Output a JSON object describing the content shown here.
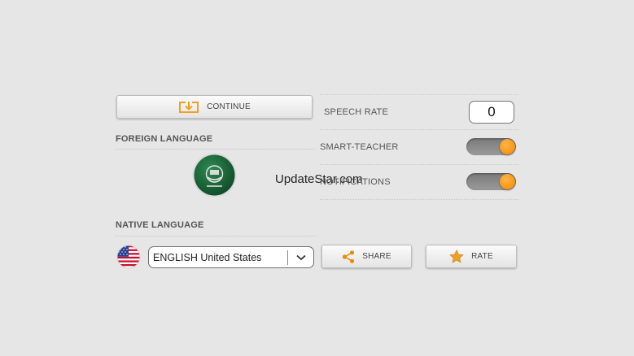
{
  "continue_button": {
    "label": "CONTINUE",
    "icon": "download-tray-icon",
    "icon_color": "#f0a020"
  },
  "foreign_language": {
    "title": "FOREIGN LANGUAGE",
    "flag_icon": "arab-league-flag-icon",
    "flag_color": "#1c6b3a"
  },
  "native_language": {
    "title": "NATIVE LANGUAGE",
    "flag_icon": "us-flag-icon",
    "selected": "ENGLISH United States"
  },
  "settings": {
    "speech_rate": {
      "label": "SPEECH RATE",
      "value": "0"
    },
    "smart_teacher": {
      "label": "SMART-TEACHER",
      "enabled": true
    },
    "notifications": {
      "label": "NOTIFICATIONS",
      "enabled": true
    }
  },
  "actions": {
    "share": {
      "label": "SHARE",
      "icon": "share-icon"
    },
    "rate": {
      "label": "RATE",
      "icon": "star-icon"
    }
  },
  "watermark": "UpdateStar.com",
  "colors": {
    "accent": "#f28a00",
    "background": "#e6e6e6"
  }
}
